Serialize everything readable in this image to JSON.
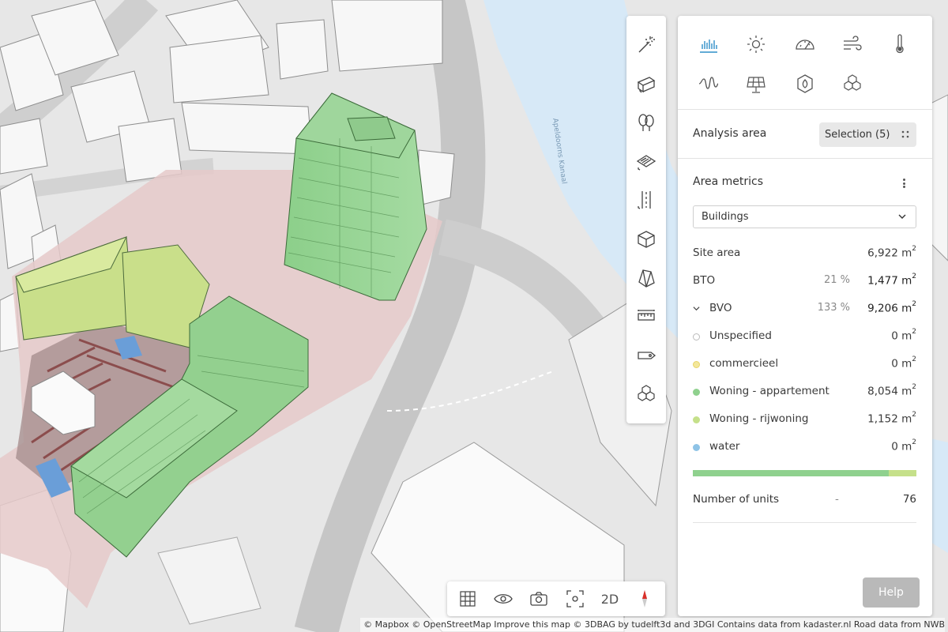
{
  "tabs": {
    "row1": [
      "bar-chart-icon",
      "sun-icon",
      "gauge-icon",
      "wind-icon",
      "thermometer-icon"
    ],
    "row2": [
      "sound-wave-icon",
      "solar-panel-icon",
      "leaf-shield-icon",
      "cubes-icon"
    ],
    "active": "bar-chart-icon",
    "accent_color": "#2f8fc9"
  },
  "analysis": {
    "label": "Analysis area",
    "selection": "Selection (5)"
  },
  "metrics": {
    "title": "Area metrics",
    "dropdown_value": "Buildings",
    "rows": {
      "site_area": {
        "label": "Site area",
        "value": "6,922",
        "unit": "m",
        "exp": "2"
      },
      "bto": {
        "label": "BTO",
        "pct": "21 %",
        "value": "1,477",
        "unit": "m",
        "exp": "2"
      },
      "bvo": {
        "label": "BVO",
        "pct": "133 %",
        "value": "9,206",
        "unit": "m",
        "exp": "2"
      }
    },
    "uses": [
      {
        "label": "Unspecified",
        "value": "0",
        "unit": "m",
        "exp": "2",
        "color": "#ffffff"
      },
      {
        "label": "commercieel",
        "value": "0",
        "unit": "m",
        "exp": "2",
        "color": "#f3e79a"
      },
      {
        "label": "Woning - appartement",
        "value": "8,054",
        "unit": "m",
        "exp": "2",
        "color": "#8fd18e"
      },
      {
        "label": "Woning - rijwoning",
        "value": "1,152",
        "unit": "m",
        "exp": "2",
        "color": "#c5e08a"
      },
      {
        "label": "water",
        "value": "0",
        "unit": "m",
        "exp": "2",
        "color": "#8ec3e6"
      }
    ],
    "usebar": [
      {
        "name": "Woning - appartement",
        "fraction": 0.875,
        "color": "#8fd18e"
      },
      {
        "name": "Woning - rijwoning",
        "fraction": 0.125,
        "color": "#c5e08a"
      }
    ],
    "units": {
      "label": "Number of units",
      "dash": "-",
      "value": "76"
    }
  },
  "help_label": "Help",
  "left_tools": [
    "magic-wand-icon",
    "building-block-icon",
    "trees-icon",
    "plane-surface-icon",
    "road-lines-icon",
    "cube-icon",
    "prism-icon",
    "ruler-icon",
    "tag-icon",
    "stacked-cubes-icon"
  ],
  "bottom_tools": {
    "items": [
      "grid-frame-icon",
      "eye-icon",
      "camera-icon",
      "focus-icon",
      "compass-icon"
    ],
    "mode_2d": "2D"
  },
  "map_labels": {
    "river": "Apeldoorns Kanaal"
  },
  "attribution": "© Mapbox  © OpenStreetMap  Improve this map  © 3DBAG by tudelft3d and 3DGI  Contains data from kadaster.nl  Road data from NWB"
}
